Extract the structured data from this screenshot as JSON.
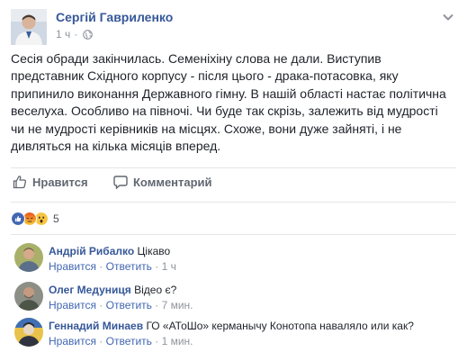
{
  "post": {
    "author": "Сергій Гавриленко",
    "time": "1 ч",
    "lines": [
      "Сесія обради закінчилась. Семеніхіну слова не дали. Виступив",
      "представник Східного корпусу - після цього - драка-потасовка, яку",
      "припинило виконання Державного гімну. В нашій області настає політична",
      "веселуха. Особливо на півночі. Чи буде так скрізь, залежить від мудрості",
      "чи не мудрості керівників на місцях. Схоже, вони дуже зайняті, і не",
      "дивляться на кілька місяців вперед."
    ]
  },
  "actions": {
    "like": "Нравится",
    "comment": "Комментарий"
  },
  "reactions": {
    "count": "5",
    "icons": [
      "like-icon",
      "angry-icon",
      "wow-icon"
    ]
  },
  "comments": [
    {
      "name": "Андрій Рибалко",
      "text": "Цікаво",
      "like": "Нравится",
      "reply": "Ответить",
      "time": "1 ч"
    },
    {
      "name": "Олег Медуниця",
      "text": "Відео є?",
      "like": "Нравится",
      "reply": "Ответить",
      "time": "7 мин."
    },
    {
      "name": "Геннадий Минаев",
      "text": "ГО «АТоШо» керманычу Конотопа наваляло или как?",
      "like": "Нравится",
      "reply": "Ответить",
      "time": "1 мин."
    }
  ],
  "colors": {
    "link": "#365899",
    "meta": "#90949c",
    "like_blue": "#4267b2"
  }
}
